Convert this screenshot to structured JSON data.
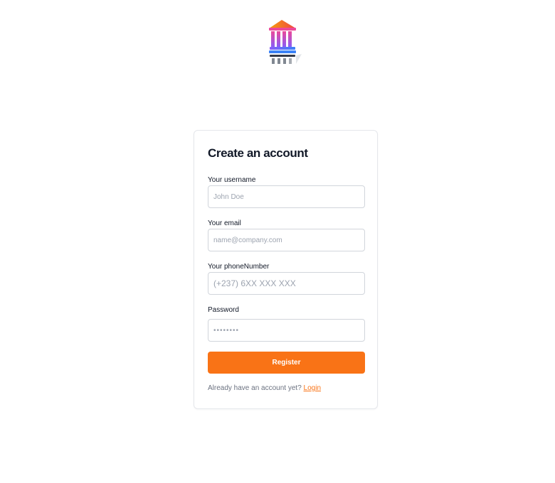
{
  "form": {
    "title": "Create an account",
    "username": {
      "label": "Your username",
      "placeholder": "John Doe"
    },
    "email": {
      "label": "Your email",
      "placeholder": "name@company.com"
    },
    "phone": {
      "label": "Your phoneNumber",
      "placeholder": "(+237) 6XX XXX XXX"
    },
    "password": {
      "label": "Password",
      "placeholder": "••••••••"
    },
    "register_label": "Register",
    "footer_text": "Already have an account yet?",
    "login_label": "Login"
  },
  "colors": {
    "accent": "#f97316",
    "border": "#e5e7eb",
    "muted_text": "#6b7280"
  },
  "icons": {
    "logo": "bank-building-icon"
  }
}
